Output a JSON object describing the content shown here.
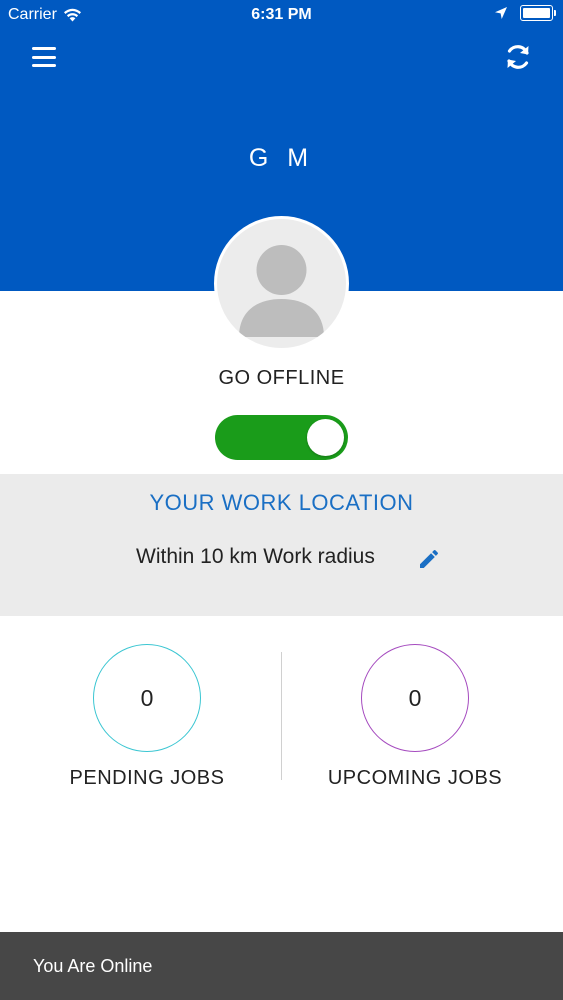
{
  "colors": {
    "header_bg": "#0059c1",
    "toggle_on": "#1a9c1a",
    "link_blue": "#1a6fc4",
    "pending_ring": "#3bc6d2",
    "upcoming_ring": "#a54bbf",
    "snackbar_bg": "#474747"
  },
  "status_bar": {
    "carrier": "Carrier",
    "time": "6:31 PM"
  },
  "header": {
    "menu_icon": "hamburger-menu-icon",
    "refresh_icon": "refresh-icon",
    "user_name": "G M"
  },
  "availability": {
    "label": "GO OFFLINE",
    "toggle_on": true
  },
  "work_location": {
    "title": "YOUR WORK LOCATION",
    "radius_text": "Within 10 km Work radius",
    "edit_icon": "pencil-icon"
  },
  "jobs": {
    "pending": {
      "count": "0",
      "label": "PENDING JOBS"
    },
    "upcoming": {
      "count": "0",
      "label": "UPCOMING JOBS"
    }
  },
  "snackbar": {
    "message": "You Are Online"
  }
}
